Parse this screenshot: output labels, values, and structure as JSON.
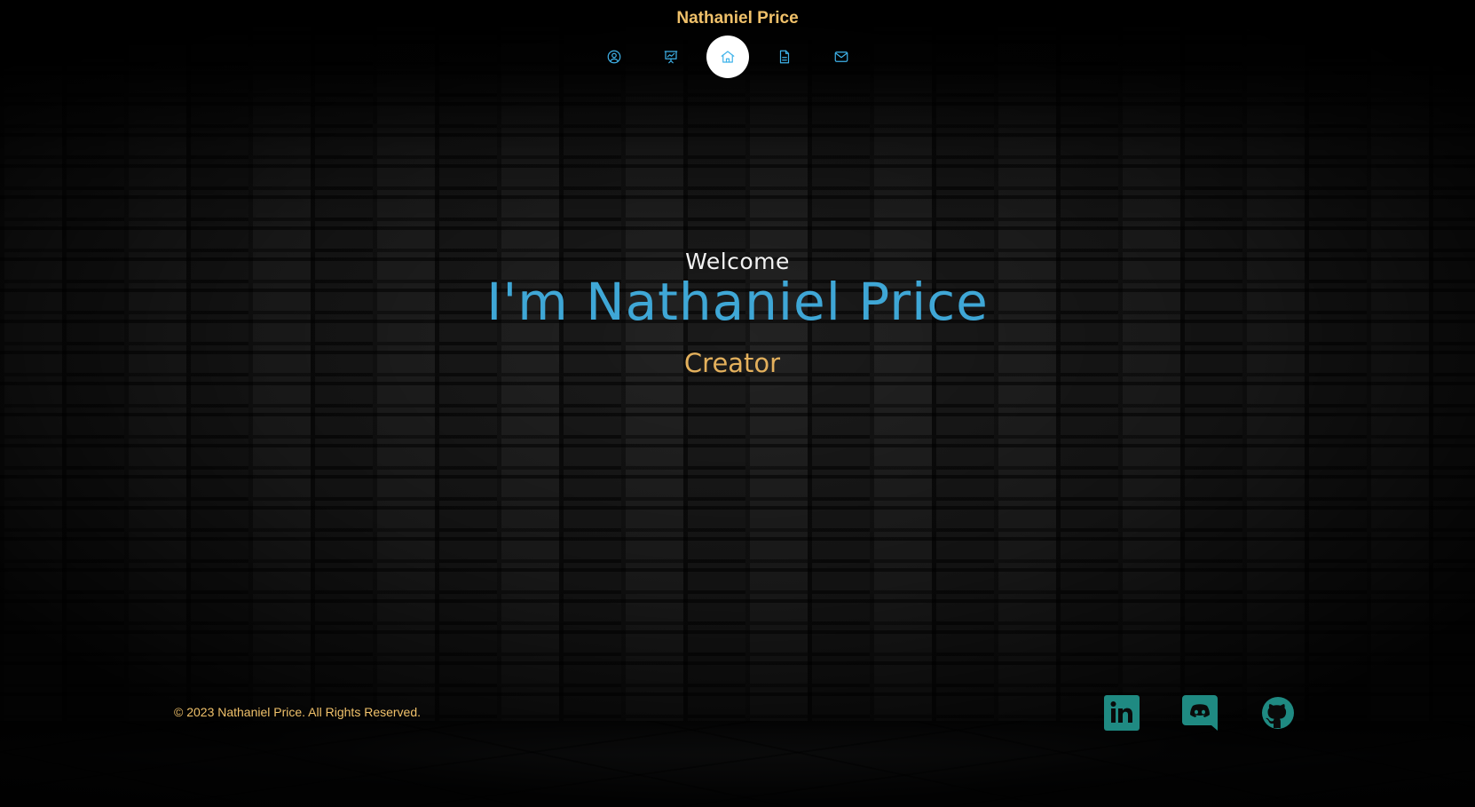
{
  "header": {
    "site_title": "Nathaniel Price",
    "nav": [
      {
        "name": "about",
        "icon": "user-circle-icon",
        "active": false
      },
      {
        "name": "portfolio",
        "icon": "presentation-chart-icon",
        "active": false
      },
      {
        "name": "home",
        "icon": "home-icon",
        "active": true
      },
      {
        "name": "resume",
        "icon": "document-icon",
        "active": false
      },
      {
        "name": "contact",
        "icon": "envelope-icon",
        "active": false
      }
    ]
  },
  "hero": {
    "greeting": "Welcome",
    "headline": "I'm Nathaniel Price",
    "role": "Creator"
  },
  "footer": {
    "copyright": "© 2023 Nathaniel Price. All Rights Reserved.",
    "social": [
      {
        "name": "linkedin",
        "icon": "linkedin-icon"
      },
      {
        "name": "discord",
        "icon": "discord-icon"
      },
      {
        "name": "github",
        "icon": "github-icon"
      }
    ]
  },
  "colors": {
    "accent_gold": "#f0c16a",
    "accent_blue": "#3fa7d6",
    "social_teal": "#1f8a82"
  }
}
